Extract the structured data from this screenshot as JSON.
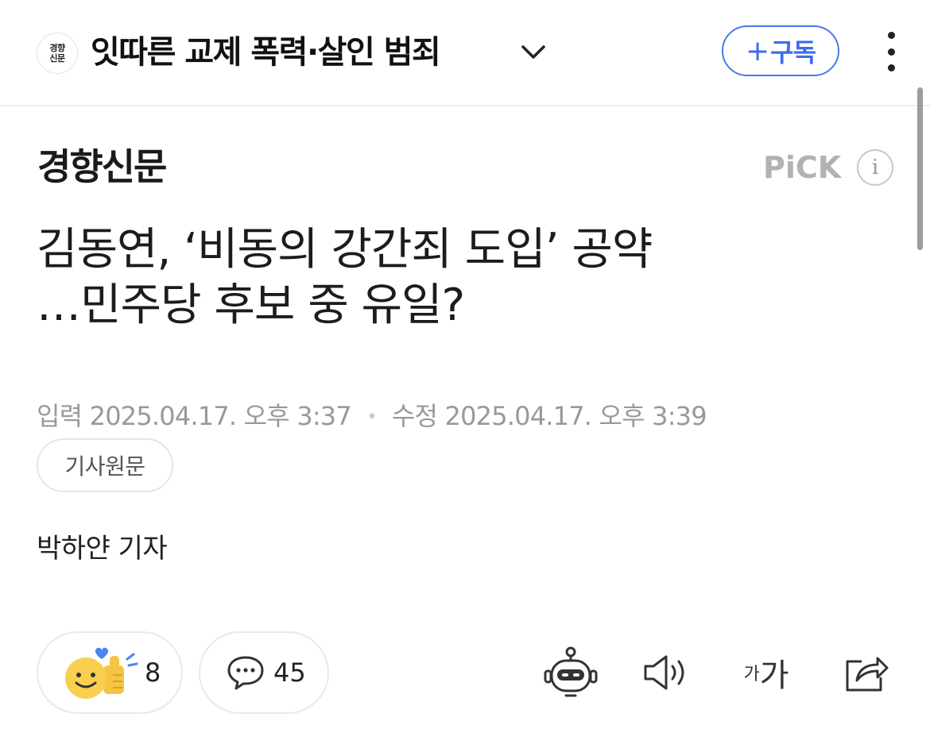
{
  "header": {
    "press_logo_line1": "경향",
    "press_logo_line2": "신문",
    "topic_title": "잇따른 교제 폭력·살인 범죄",
    "subscribe_plus": "+",
    "subscribe_label": "구독"
  },
  "press": {
    "name": "경향신문",
    "pick_label": "PiCK",
    "info_label": "i"
  },
  "article": {
    "headline_line1": "김동연, ‘비동의 강간죄 도입’ 공약",
    "headline_line2": "…민주당 후보 중 유일?",
    "input_label": "입력",
    "input_time": "2025.04.17. 오후 3:37",
    "separator": "•",
    "modified_label": "수정",
    "modified_time": "2025.04.17. 오후 3:39",
    "original_button": "기사원문",
    "reporter": "박하얀 기자"
  },
  "actions": {
    "reaction_count": "8",
    "comment_count": "45",
    "font_small": "가",
    "font_big": "가"
  },
  "icons": {
    "chevron": "chevron-down-icon",
    "kebab": "more-vertical-icon",
    "reaction": "smile-thumbs-up-icon",
    "comment": "speech-bubble-icon",
    "bot": "robot-summary-icon",
    "audio": "speaker-icon",
    "font": "font-size-icon",
    "share": "share-icon"
  },
  "colors": {
    "accent": "#3d6ce8",
    "muted_text": "#999999",
    "pick_gray": "#b2b2b2"
  }
}
